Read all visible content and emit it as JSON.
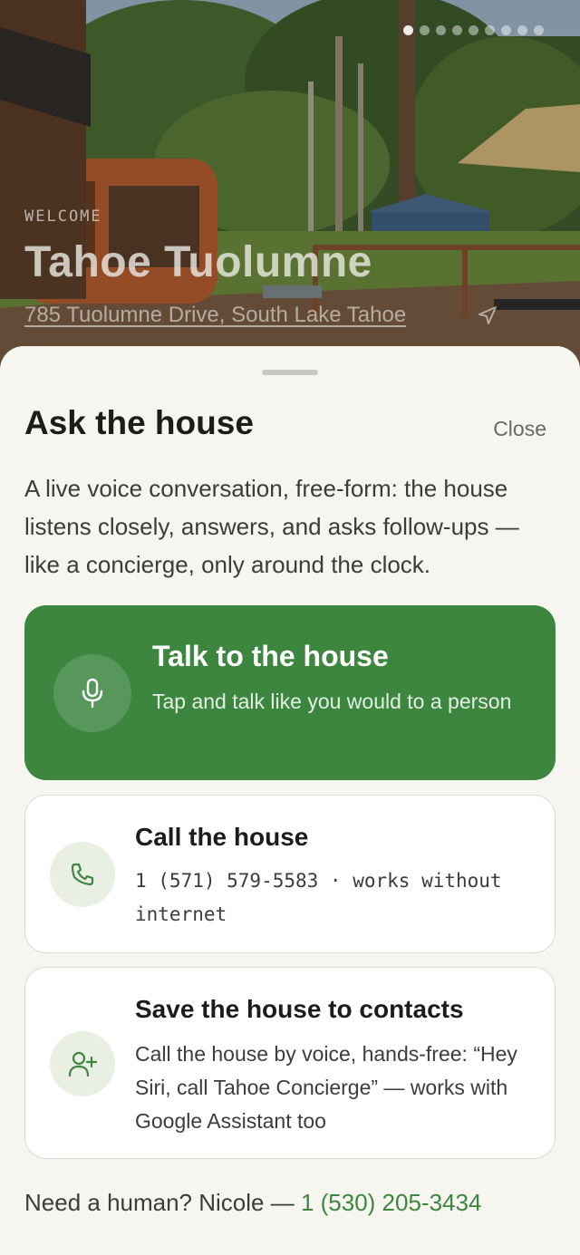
{
  "hero": {
    "welcome": "WELCOME",
    "title": "Tahoe Tuolumne",
    "address": "785 Tuolumne Drive, South Lake Tahoe",
    "carousel": {
      "total": 9,
      "active_index": 1
    }
  },
  "sheet": {
    "title": "Ask the house",
    "close_label": "Close",
    "description": "A live voice conversation, free-form: the house listens closely, answers, and asks follow-ups — like a concierge, only around the clock."
  },
  "options": {
    "talk": {
      "title": "Talk to the house",
      "subtitle": "Tap and talk like you would to a person",
      "icon": "microphone-icon"
    },
    "call": {
      "title": "Call the house",
      "subtitle": "1 (571) 579-5583 · works without internet",
      "icon": "phone-icon"
    },
    "save": {
      "title": "Save the house to contacts",
      "subtitle": "Call the house by voice, hands-free: “Hey Siri, call Tahoe Concierge” — works with Google Assistant too",
      "icon": "add-contact-icon"
    }
  },
  "footer": {
    "prefix": "Need a human? Nicole — ",
    "phone": "1 (530) 205-3434"
  },
  "colors": {
    "accent": "#3d8640",
    "sheet_bg": "#f6f5f0",
    "icon_bg": "#e9efe3"
  }
}
